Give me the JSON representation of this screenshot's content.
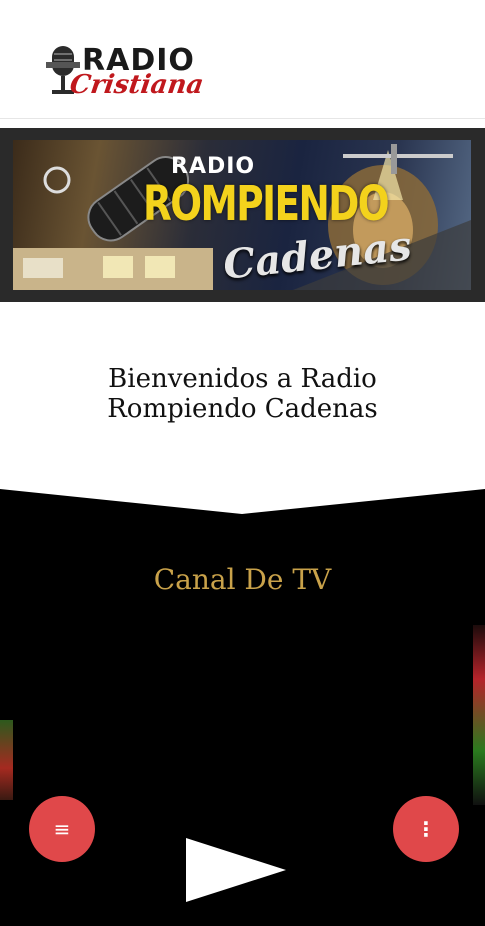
{
  "header": {
    "logo_word1": "RADIO",
    "logo_word2": "Cristiana"
  },
  "banner": {
    "line1": "RADIO",
    "line2": "ROMPIENDO",
    "line3": "Cadenas"
  },
  "welcome": {
    "line1": "Bienvenidos a Radio",
    "line2": "Rompiendo Cadenas"
  },
  "tv": {
    "title": "Canal De TV"
  },
  "fabs": {
    "left_icon": "menu-icon",
    "left_glyph": "≡",
    "right_icon": "more-vertical-icon",
    "right_glyph": "⋮"
  },
  "colors": {
    "fab": "#e0484a",
    "tv_title": "#c9a24a",
    "logo_red": "#c0181d"
  }
}
